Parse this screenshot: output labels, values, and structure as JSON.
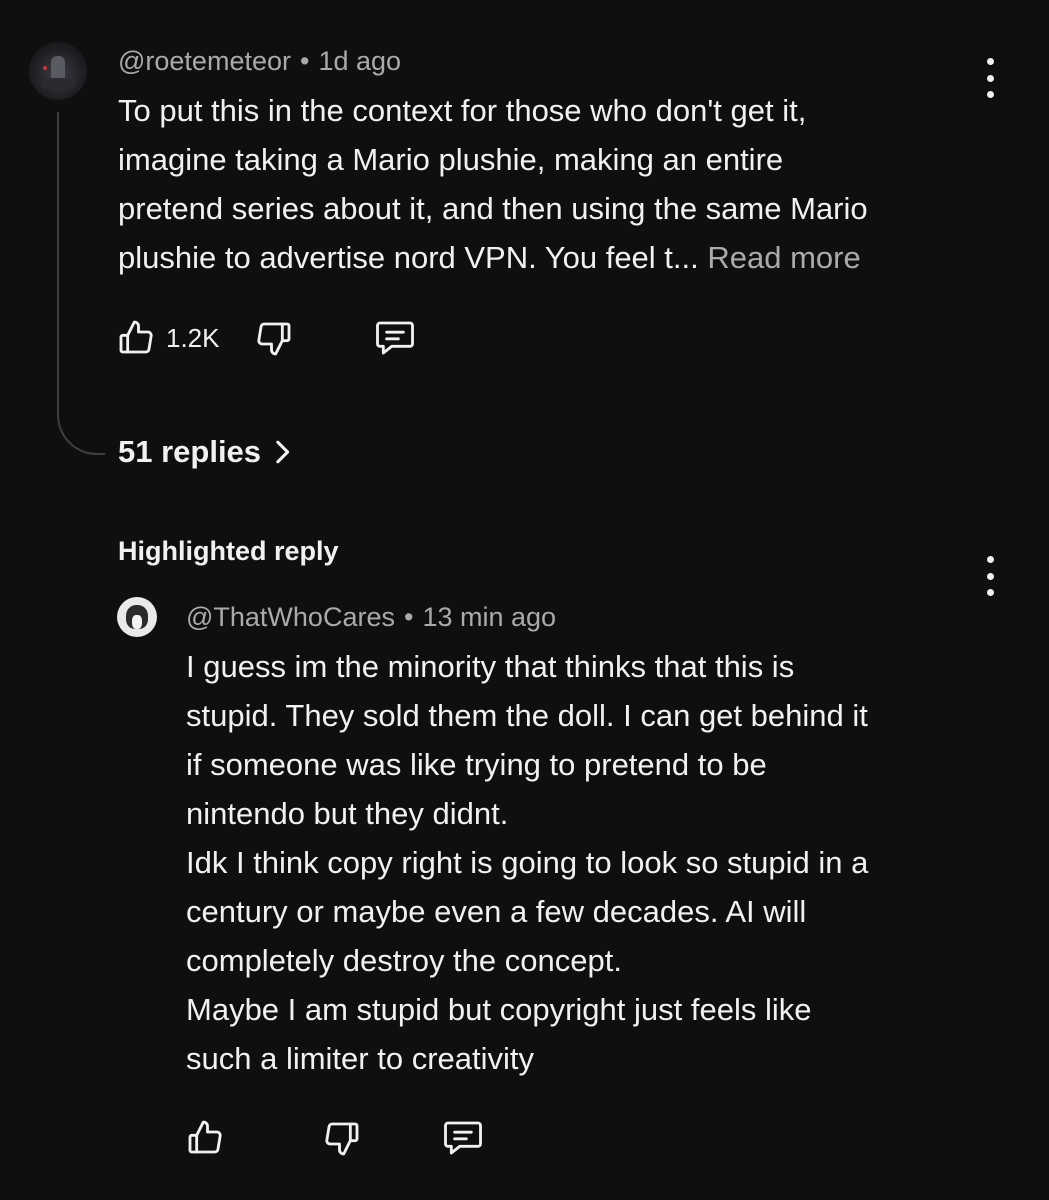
{
  "top_comment": {
    "handle": "@roetemeteor",
    "separator": "•",
    "time": "1d ago",
    "lines": [
      "To put this in the context for those who don't get it,",
      "imagine taking a Mario plushie, making an entire",
      "pretend series about it, and then using the same Mario",
      "plushie to advertise nord VPN.  You feel t..."
    ],
    "read_more": "Read more",
    "like_count": "1.2K",
    "replies_label": "51 replies",
    "icons": {
      "menu": "more-vertical-icon",
      "like": "thumbs-up-icon",
      "dislike": "thumbs-down-icon",
      "reply": "comment-icon",
      "chevron": "chevron-right-icon"
    }
  },
  "highlighted": {
    "label": "Highlighted reply",
    "handle": "@ThatWhoCares",
    "separator": "•",
    "time": "13 min ago",
    "lines": [
      "I guess im the minority that thinks that this is",
      "stupid. They sold them the doll. I can get behind it",
      "if someone was like trying to pretend to be",
      "nintendo but they didnt.",
      "Idk I think copy right is going to look so stupid in a",
      "century or maybe even a few decades. AI will",
      "completely destroy the concept.",
      "Maybe I am stupid but copyright just feels like",
      "such a limiter to creativity"
    ]
  },
  "colors": {
    "background": "#0f0f0f",
    "primary_text": "#f1f1f1",
    "secondary_text": "#aaaaaa",
    "thread_line": "#3f3f3f"
  }
}
